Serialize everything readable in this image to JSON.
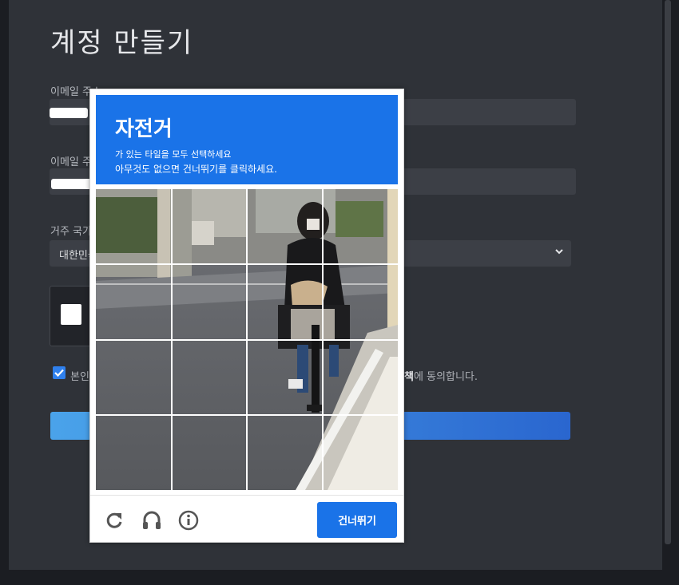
{
  "page": {
    "title": "계정 만들기",
    "email_label": "이메일 주소",
    "email_confirm_label": "이메일 주소 확인",
    "country_label": "거주 국가",
    "country_value": "대한민국",
    "agree_prefix": "본인",
    "agree_bold": "책",
    "agree_suffix": "에 동의합니다."
  },
  "captcha": {
    "header": {
      "target_word": "자전거",
      "instruction": "가 있는 타일을 모두 선택하세요",
      "skip_hint": "아무것도 없으면 건너뛰기를 클릭하세요."
    },
    "footer": {
      "reload_icon": "reload-icon",
      "audio_icon": "headphones-icon",
      "info_icon": "info-icon",
      "skip_label": "건너뛰기"
    },
    "grid": {
      "rows": 4,
      "cols": 4
    }
  },
  "colors": {
    "accent": "#1a73e8",
    "page_bg": "#2f3238",
    "field_bg": "#3c3f46",
    "checkbox": "#2f80ed"
  }
}
